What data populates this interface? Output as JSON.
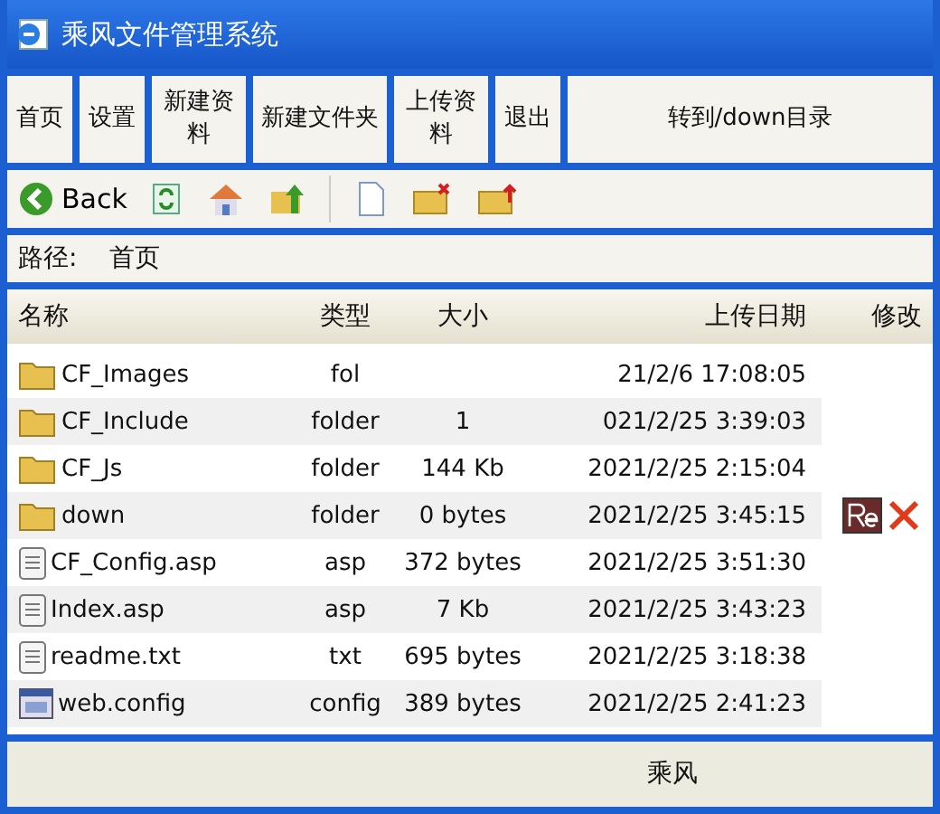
{
  "window": {
    "title": "乘风文件管理系统"
  },
  "nav_buttons": [
    "首页",
    "设置",
    "新建资料",
    "新建文件夹",
    "上传资料",
    "退出",
    "转到/down目录"
  ],
  "toolbar": {
    "back_label": "Back"
  },
  "path": {
    "label": "路径:",
    "value": "首页"
  },
  "table": {
    "columns": [
      "名称",
      "类型",
      "大小",
      "上传日期",
      "修改"
    ],
    "rows": [
      {
        "kind": "folder",
        "name": "CF_Images",
        "type": "fol",
        "size": "",
        "date": "21/2/6 17:08:05",
        "actions": false
      },
      {
        "kind": "folder",
        "name": "CF_Include",
        "type": "folder",
        "size": "1",
        "date": "021/2/25 3:39:03",
        "actions": false
      },
      {
        "kind": "folder",
        "name": "CF_Js",
        "type": "folder",
        "size": "144 Kb",
        "date": "2021/2/25 2:15:04",
        "actions": false
      },
      {
        "kind": "folder",
        "name": "down",
        "type": "folder",
        "size": "0 bytes",
        "date": "2021/2/25 3:45:15",
        "actions": true
      },
      {
        "kind": "file",
        "name": "CF_Config.asp",
        "type": "asp",
        "size": "372 bytes",
        "date": "2021/2/25 3:51:30",
        "actions": false
      },
      {
        "kind": "file",
        "name": "Index.asp",
        "type": "asp",
        "size": "7 Kb",
        "date": "2021/2/25 3:43:23",
        "actions": false
      },
      {
        "kind": "file",
        "name": "readme.txt",
        "type": "txt",
        "size": "695 bytes",
        "date": "2021/2/25 3:18:38",
        "actions": false
      },
      {
        "kind": "config",
        "name": "web.config",
        "type": "config",
        "size": "389 bytes",
        "date": "2021/2/25 2:41:23",
        "actions": false
      }
    ]
  },
  "footer": {
    "text": "乘风"
  }
}
